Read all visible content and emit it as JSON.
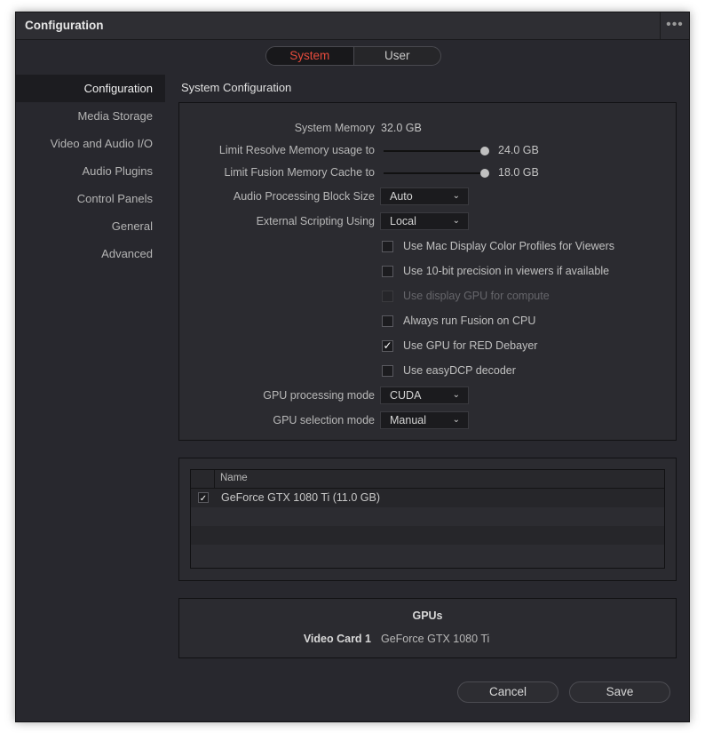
{
  "window": {
    "title": "Configuration",
    "more_icon": "ellipsis-icon"
  },
  "tabs": [
    {
      "label": "System",
      "active": true
    },
    {
      "label": "User",
      "active": false
    }
  ],
  "colors": {
    "accent": "#e64b3c",
    "background": "#28282e",
    "panel": "#2b2b30"
  },
  "sidebar": {
    "items": [
      {
        "label": "Configuration",
        "selected": true
      },
      {
        "label": "Media Storage"
      },
      {
        "label": "Video and Audio I/O"
      },
      {
        "label": "Audio Plugins"
      },
      {
        "label": "Control Panels"
      },
      {
        "label": "General"
      },
      {
        "label": "Advanced"
      }
    ]
  },
  "section_title": "System Configuration",
  "system": {
    "memory_label": "System Memory",
    "memory_value": "32.0 GB",
    "resolve_mem_label": "Limit Resolve Memory usage to",
    "resolve_mem_value": "24.0 GB",
    "resolve_mem_fraction": 1.0,
    "fusion_cache_label": "Limit Fusion Memory Cache to",
    "fusion_cache_value": "18.0 GB",
    "fusion_cache_fraction": 1.0,
    "audio_block_label": "Audio Processing Block Size",
    "audio_block_value": "Auto",
    "scripting_label": "External Scripting Using",
    "scripting_value": "Local",
    "gpu_mode_label": "GPU processing mode",
    "gpu_mode_value": "CUDA",
    "gpu_select_label": "GPU selection mode",
    "gpu_select_value": "Manual"
  },
  "checkboxes": [
    {
      "label": "Use Mac Display Color Profiles for Viewers",
      "checked": false,
      "disabled": false
    },
    {
      "label": "Use 10-bit precision in viewers if available",
      "checked": false,
      "disabled": false
    },
    {
      "label": "Use display GPU for compute",
      "checked": false,
      "disabled": true
    },
    {
      "label": "Always run Fusion on CPU",
      "checked": false,
      "disabled": false
    },
    {
      "label": "Use GPU for RED Debayer",
      "checked": true,
      "disabled": false
    },
    {
      "label": "Use easyDCP decoder",
      "checked": false,
      "disabled": false
    }
  ],
  "gpu_table": {
    "header_name": "Name",
    "rows": [
      {
        "name": "GeForce GTX 1080 Ti (11.0 GB)",
        "checked": true
      }
    ]
  },
  "gpus_info": {
    "title": "GPUs",
    "card_label": "Video Card 1",
    "card_value": "GeForce GTX 1080 Ti"
  },
  "footer": {
    "cancel_label": "Cancel",
    "save_label": "Save"
  }
}
